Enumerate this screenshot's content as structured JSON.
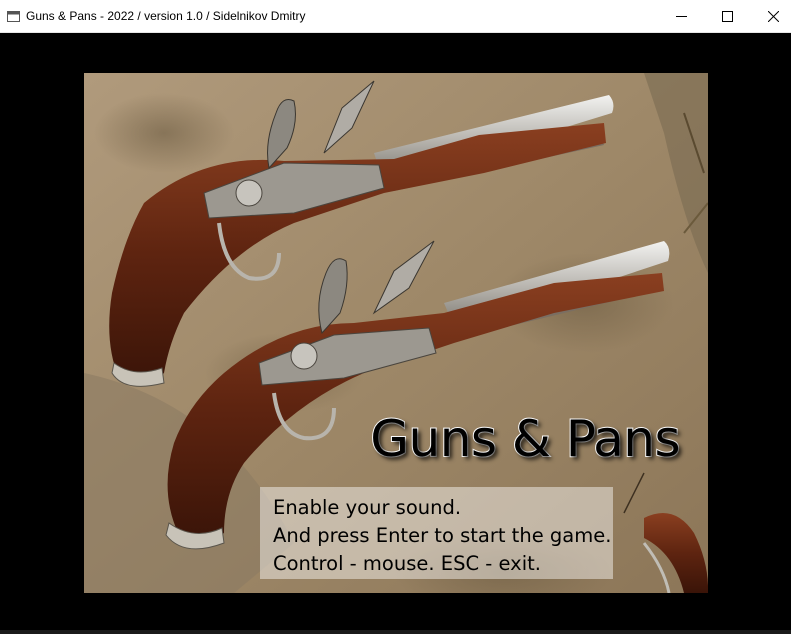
{
  "window": {
    "title": "Guns & Pans - 2022 / version 1.0 / Sidelnikov Dmitry",
    "icon": "window-app-icon",
    "controls": {
      "minimize_icon": "minimize-icon",
      "maximize_icon": "maximize-icon",
      "close_icon": "close-icon"
    }
  },
  "splash": {
    "image_subject": "two antique flintlock pistols on stone pavement",
    "game_title": "Guns & Pans",
    "instructions": [
      "Enable your sound.",
      "And press Enter to start the game.",
      "Control - mouse. ESC - exit."
    ]
  },
  "colors": {
    "background": "#000000",
    "titlebar": "#ffffff",
    "title_text": "#000000",
    "title_outline": "#ffffff",
    "info_box": "rgba(255,255,255,0.45)"
  }
}
